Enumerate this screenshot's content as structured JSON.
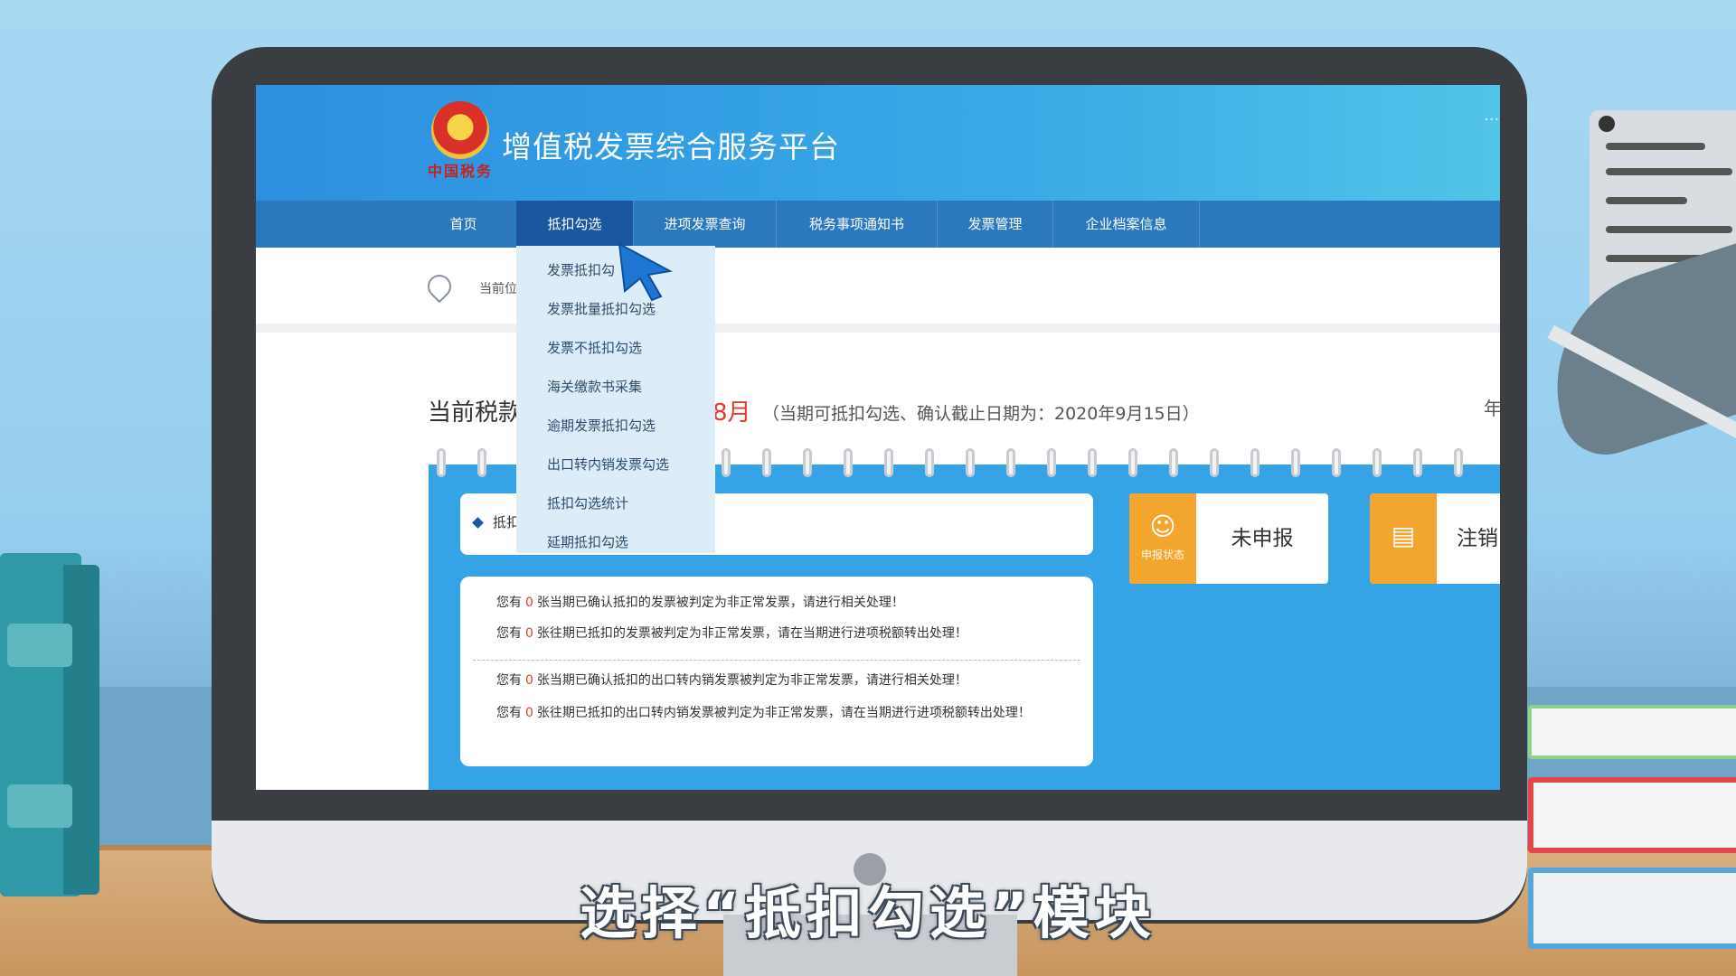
{
  "site": {
    "title": "增值税发票综合服务平台",
    "emblem_text": "中国税务",
    "more": "···"
  },
  "nav": {
    "items": [
      {
        "label": "首页"
      },
      {
        "label": "抵扣勾选"
      },
      {
        "label": "进项发票查询"
      },
      {
        "label": "税务事项通知书"
      },
      {
        "label": "发票管理"
      },
      {
        "label": "企业档案信息"
      }
    ],
    "active_index": 1
  },
  "dropdown": {
    "items": [
      {
        "label": "发票抵扣勾"
      },
      {
        "label": "发票批量抵扣勾选"
      },
      {
        "label": "发票不抵扣勾选"
      },
      {
        "label": "海关缴款书采集"
      },
      {
        "label": "逾期发票抵扣勾选"
      },
      {
        "label": "出口转内销发票勾选"
      },
      {
        "label": "抵扣勾选统计"
      },
      {
        "label": "延期抵扣勾选"
      }
    ]
  },
  "breadcrumb": {
    "text": "当前位"
  },
  "period": {
    "label": "当前税款",
    "month": "8月",
    "note": "（当期可抵扣勾选、确认截止日期为：2020年9月15日）",
    "right": "年"
  },
  "bar": {
    "text": "抵扣"
  },
  "messages": [
    {
      "prefix": "您有",
      "count": "0",
      "text": "张当期已确认抵扣的发票被判定为非正常发票，请进行相关处理！"
    },
    {
      "prefix": "您有",
      "count": "0",
      "text": "张往期已抵扣的发票被判定为非正常发票，请在当期进行进项税额转出处理！"
    },
    {
      "prefix": "您有",
      "count": "0",
      "text": "张当期已确认抵扣的出口转内销发票被判定为非正常发票，请进行相关处理！"
    },
    {
      "prefix": "您有",
      "count": "0",
      "text": "张往期已抵扣的出口转内销发票被判定为非正常发票，请在当期进行进项税额转出处理！"
    }
  ],
  "stats": {
    "declare_caption": "申报状态",
    "declare_value": "未申报",
    "cancel_value": "注销"
  },
  "caption": "选择“抵扣勾选”模块",
  "colors": {
    "header_blue": "#2d8fe0",
    "nav_blue": "#2b78bf",
    "nav_active": "#1b57a0",
    "accent_red": "#e4392c",
    "stat_orange": "#f3a62f"
  }
}
